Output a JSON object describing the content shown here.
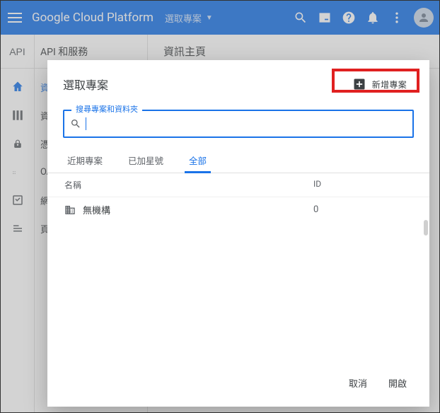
{
  "header": {
    "brand": "Google Cloud Platform",
    "project_label": "選取專案"
  },
  "subheader": {
    "api_logo": "API",
    "api_title": "API 和服務",
    "page_title": "資訊主頁"
  },
  "sidebar_labels": [
    "資",
    "資",
    "憑",
    "OA",
    "網",
    "頁"
  ],
  "stub_note": "專案",
  "dialog": {
    "title": "選取專案",
    "new_project": "新增專案",
    "search_legend": "搜尋專案和資料夾",
    "tabs": {
      "recent": "近期專案",
      "starred": "已加星號",
      "all": "全部"
    },
    "columns": {
      "name": "名稱",
      "id": "ID"
    },
    "rows": [
      {
        "name": "無機構",
        "id": "0"
      }
    ],
    "cancel": "取消",
    "open": "開啟"
  }
}
